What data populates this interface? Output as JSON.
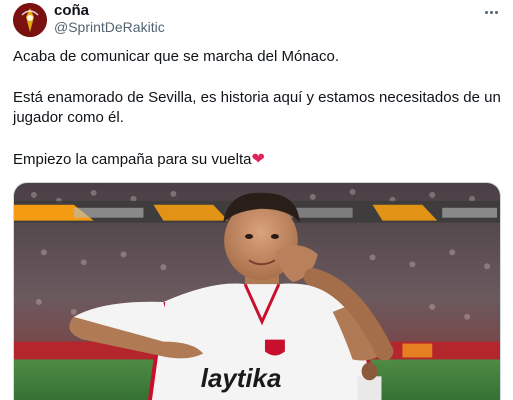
{
  "tweet": {
    "author": {
      "display_name": "coña",
      "handle": "@SprintDeRakitic"
    },
    "lines": [
      "Acaba de comunicar que se marcha del Mónaco.",
      "Está enamorado de Sevilla, es historia aquí y estamos necesitados de un jugador como él.",
      "Empiezo la campaña para su vuelta"
    ],
    "emoji": "❤",
    "media": {
      "shirt_sponsor": "laytika"
    }
  },
  "colors": {
    "text_primary": "#0f1419",
    "text_secondary": "#536471",
    "heart": "#e0245e",
    "pitch": "#3e7a3a",
    "shirt": "#f4f4f4",
    "shirt_trim": "#c8102e"
  },
  "icons": {
    "more": "more-horizontal-icon"
  }
}
